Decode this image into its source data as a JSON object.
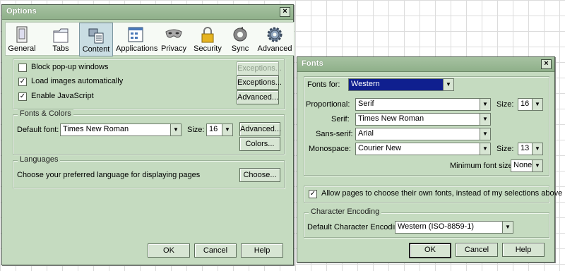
{
  "options": {
    "title": "Options",
    "tabs": [
      {
        "label": "General",
        "icon": "general-icon"
      },
      {
        "label": "Tabs",
        "icon": "tabs-icon"
      },
      {
        "label": "Content",
        "icon": "content-icon"
      },
      {
        "label": "Applications",
        "icon": "applications-icon"
      },
      {
        "label": "Privacy",
        "icon": "privacy-mask-icon"
      },
      {
        "label": "Security",
        "icon": "security-lock-icon"
      },
      {
        "label": "Sync",
        "icon": "sync-icon"
      },
      {
        "label": "Advanced",
        "icon": "advanced-gear-icon"
      }
    ],
    "block_popups_label": "Block pop-up windows",
    "load_images_label": "Load images automatically",
    "enable_js_label": "Enable JavaScript",
    "exceptions_label": "Exceptions...",
    "advanced_label": "Advanced...",
    "fonts_colors_legend": "Fonts & Colors",
    "default_font_label": "Default font:",
    "default_font_value": "Times New Roman",
    "size_label": "Size:",
    "size_value": "16",
    "colors_label": "Colors...",
    "languages_legend": "Languages",
    "languages_text": "Choose your preferred language for displaying pages",
    "choose_label": "Choose...",
    "ok": "OK",
    "cancel": "Cancel",
    "help": "Help"
  },
  "fonts": {
    "title": "Fonts",
    "fonts_for_label": "Fonts for:",
    "fonts_for_value": "Western",
    "proportional_label": "Proportional:",
    "proportional_value": "Serif",
    "serif_label": "Serif:",
    "serif_value": "Times New Roman",
    "sans_label": "Sans-serif:",
    "sans_value": "Arial",
    "mono_label": "Monospace:",
    "mono_value": "Courier New",
    "size_label": "Size:",
    "prop_size": "16",
    "mono_size": "13",
    "min_size_label": "Minimum font size:",
    "min_size_value": "None",
    "allow_label": "Allow pages to choose their own fonts, instead of my selections above",
    "encoding_legend": "Character Encoding",
    "encoding_label": "Default Character Encoding:",
    "encoding_value": "Western (ISO-8859-1)",
    "ok": "OK",
    "cancel": "Cancel",
    "help": "Help"
  }
}
